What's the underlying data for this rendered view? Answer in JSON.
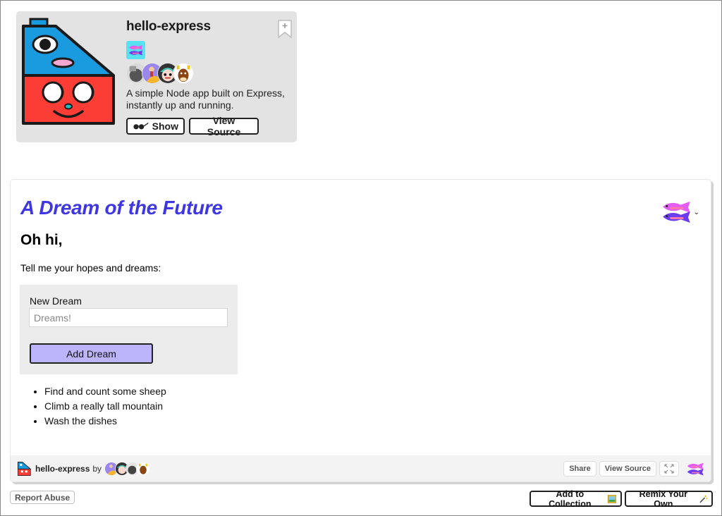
{
  "project": {
    "name": "hello-express",
    "description": "A simple Node app built on Express, instantly up and running.",
    "buttons": {
      "show": "Show",
      "view_source": "View Source"
    },
    "icons": {
      "bookmark": "bookmark-add-icon",
      "show": "sunglasses-icon",
      "team": "fish-team-icon"
    },
    "collaborators": [
      {
        "avatar": "collaborator-avatar-1"
      },
      {
        "avatar": "collaborator-avatar-2"
      },
      {
        "avatar": "collaborator-avatar-3"
      },
      {
        "avatar": "collaborator-avatar-4"
      }
    ]
  },
  "app": {
    "title": "A Dream of the Future",
    "greeting": "Oh hi,",
    "prompt": "Tell me your hopes and dreams:",
    "form": {
      "label": "New Dream",
      "input_value": "",
      "input_placeholder": "Dreams!",
      "submit_label": "Add Dream"
    },
    "dreams": [
      "Find and count some sheep",
      "Climb a really tall mountain",
      "Wash the dishes"
    ],
    "colors": {
      "title": "#3e35e3",
      "button": "#bcb5fb",
      "form_bg": "#ececec"
    }
  },
  "embed_footer": {
    "project_name": "hello-express",
    "by": "by",
    "share": "Share",
    "view_source": "View Source",
    "fullscreen_icon": "expand-icon"
  },
  "page_actions": {
    "report_abuse": "Report Abuse",
    "add_to_collection": "Add to Collection",
    "add_to_collection_icon": "picture-frame-icon",
    "remix": "Remix Your Own",
    "remix_icon": "magic-wand-icon"
  }
}
